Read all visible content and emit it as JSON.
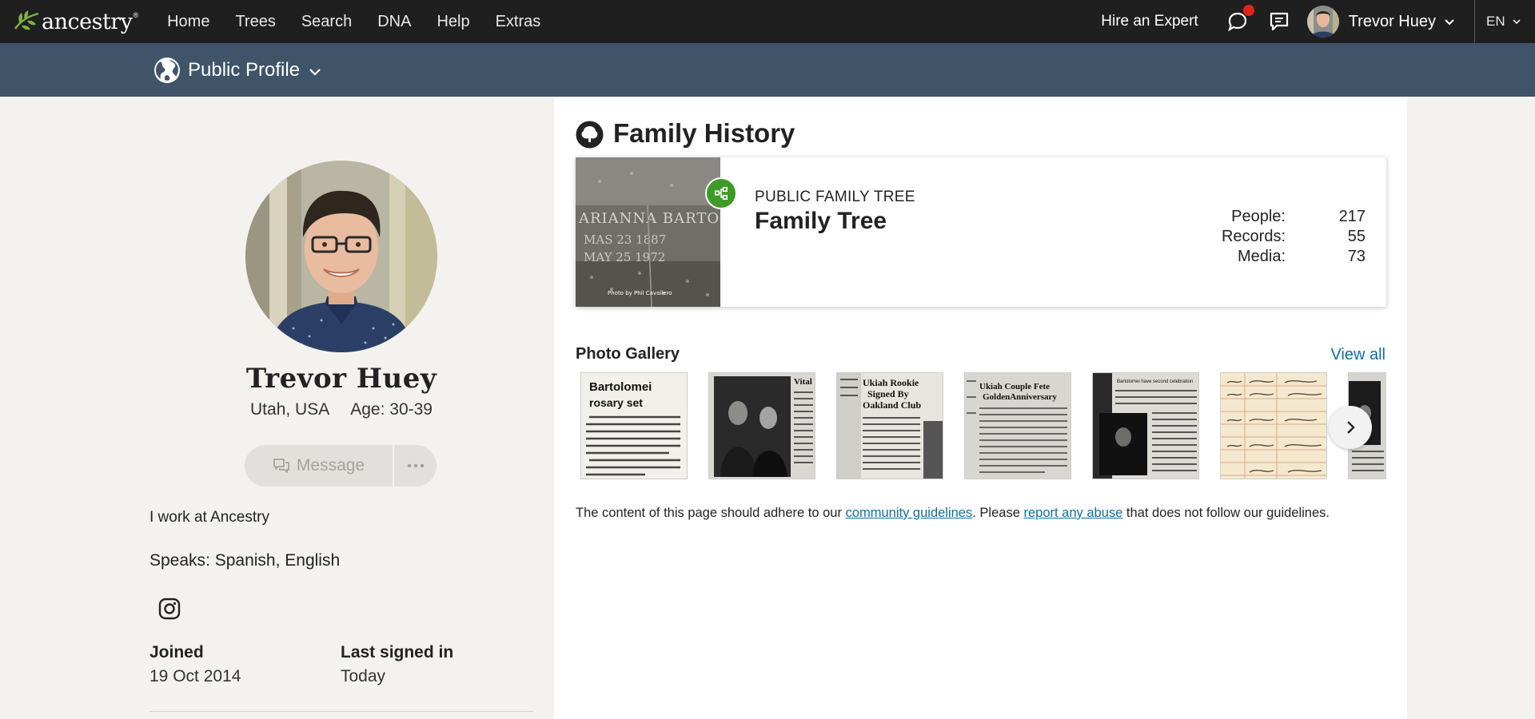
{
  "brand": {
    "logo_text": "ancestry",
    "logo_tm": "®"
  },
  "nav": {
    "items": [
      {
        "label": "Home"
      },
      {
        "label": "Trees"
      },
      {
        "label": "Search"
      },
      {
        "label": "DNA"
      },
      {
        "label": "Help"
      },
      {
        "label": "Extras"
      }
    ],
    "hire_expert": "Hire an Expert",
    "user_name": "Trevor Huey",
    "language": "EN"
  },
  "subbar": {
    "title": "Public Profile"
  },
  "profile": {
    "name": "Trevor Huey",
    "location": "Utah, USA",
    "age": "Age: 30-39",
    "message_button": "Message",
    "about": "I work at Ancestry",
    "speaks": "Speaks: Spanish, English",
    "joined_label": "Joined",
    "joined_value": "19 Oct 2014",
    "last_signed_label": "Last signed in",
    "last_signed_value": "Today"
  },
  "family_history": {
    "title": "Family History",
    "tree": {
      "label": "PUBLIC FAMILY TREE",
      "name": "Family Tree",
      "stats": [
        {
          "label": "People:",
          "value": "217"
        },
        {
          "label": "Records:",
          "value": "55"
        },
        {
          "label": "Media:",
          "value": "73"
        }
      ]
    },
    "gallery": {
      "title": "Photo Gallery",
      "view_all": "View all",
      "thumbs": [
        {
          "caption_1": "Bartolomei",
          "caption_2": "rosary set"
        },
        {
          "caption_1": "Vital"
        },
        {
          "caption_1": "Ukiah Rookie",
          "caption_2": "Signed By",
          "caption_3": "Oakland Club"
        },
        {
          "caption_1": "Ukiah Couple Fete",
          "caption_2": "GoldenAnniversary"
        },
        {
          "caption_1": "Bartolomei have second celebration"
        },
        {
          "caption_1": ""
        },
        {
          "caption_1": ""
        }
      ]
    },
    "notice": {
      "before": "The content of this page should adhere to our ",
      "link1": "community guidelines",
      "middle": ". Please ",
      "link2": "report any abuse",
      "after": " that does not follow our guidelines."
    }
  },
  "colors": {
    "topbar": "#1f1f1f",
    "subbar": "#3f5468",
    "page_bg": "#f4f2ef",
    "link": "#0b6fa4",
    "tree_badge": "#3f9a27",
    "notif": "#e1251b"
  }
}
